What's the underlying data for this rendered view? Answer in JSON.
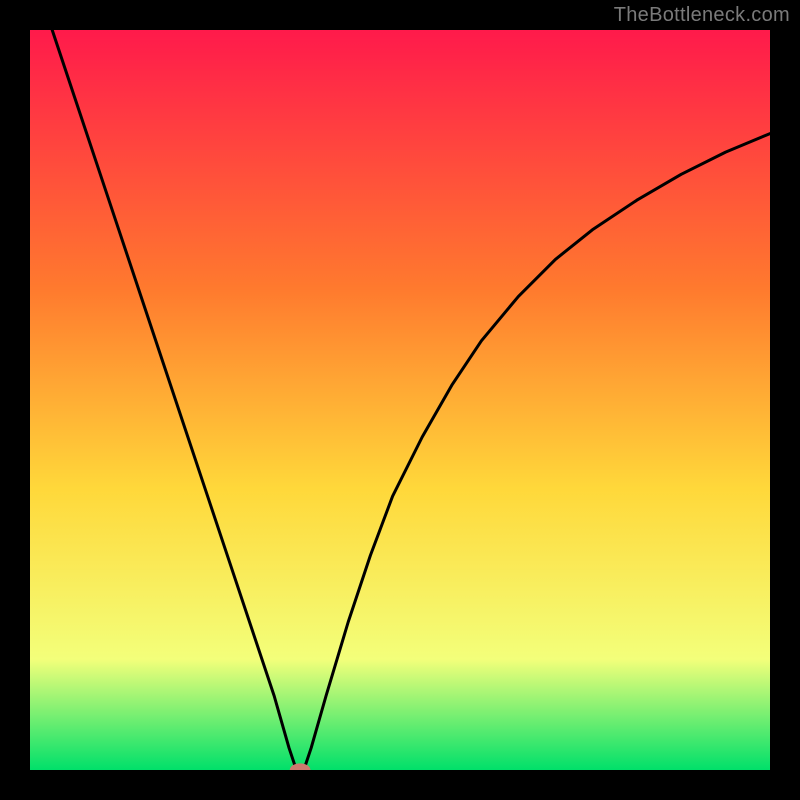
{
  "attribution": "TheBottleneck.com",
  "chart_data": {
    "type": "line",
    "title": "",
    "xlabel": "",
    "ylabel": "",
    "xlim": [
      0,
      100
    ],
    "ylim": [
      0,
      100
    ],
    "axes_visible": false,
    "grid": false,
    "background_gradient": {
      "top": "#ff1a4b",
      "mid_upper": "#ff7a2e",
      "mid": "#ffd83a",
      "mid_lower": "#f3ff7a",
      "bottom": "#00e06a"
    },
    "frame_color": "#000000",
    "frame_thickness_px": 30,
    "series": [
      {
        "name": "bottleneck-curve",
        "color": "#000000",
        "x": [
          3,
          6,
          9,
          12,
          15,
          18,
          21,
          24,
          27,
          30,
          33,
          35,
          36,
          37,
          38,
          40,
          43,
          46,
          49,
          53,
          57,
          61,
          66,
          71,
          76,
          82,
          88,
          94,
          100
        ],
        "values": [
          100,
          91,
          82,
          73,
          64,
          55,
          46,
          37,
          28,
          19,
          10,
          3,
          0,
          0,
          3,
          10,
          20,
          29,
          37,
          45,
          52,
          58,
          64,
          69,
          73,
          77,
          80.5,
          83.5,
          86
        ]
      }
    ],
    "marker": {
      "x": 36.5,
      "y": 0,
      "rx": 1.4,
      "ry": 0.9,
      "color": "#cc7a6e"
    }
  }
}
